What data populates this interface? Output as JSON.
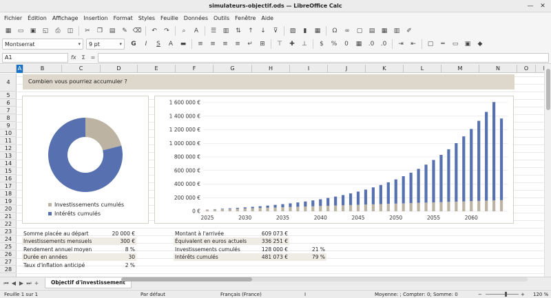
{
  "window": {
    "title": "simulateurs-objectif.ods — LibreOffice Calc",
    "minimize": "—",
    "close": "✕"
  },
  "menu": [
    "Fichier",
    "Édition",
    "Affichage",
    "Insertion",
    "Format",
    "Styles",
    "Feuille",
    "Données",
    "Outils",
    "Fenêtre",
    "Aide"
  ],
  "toolbar": {
    "font_name": "Montserrat",
    "font_size": "9 pt",
    "bold": "G",
    "italic": "I",
    "underline": "S",
    "icons1": [
      "grid-icon",
      "open-icon",
      "save-icon",
      "export-pdf-icon",
      "print-icon",
      "print-preview-icon",
      "cut-icon",
      "copy-icon",
      "paste-icon",
      "clone-format-icon",
      "clear-format-icon",
      "undo-icon",
      "redo-icon",
      "find-icon",
      "spelling-icon",
      "row-icon",
      "column-icon",
      "sort-icon",
      "sort-asc-icon",
      "sort-desc-icon",
      "autofilter-icon",
      "image-icon",
      "chart-icon",
      "pivot-icon",
      "special-char-icon",
      "hyperlink-icon",
      "comment-icon",
      "header-footer-icon",
      "freeze-icon",
      "split-icon",
      "draw-icon"
    ],
    "icons2": [
      "font-color-icon",
      "highlight-icon",
      "align-left-icon",
      "align-center-icon",
      "align-right-icon",
      "justify-icon",
      "wrap-icon",
      "merge-icon",
      "align-top-icon",
      "align-middle-icon",
      "align-bottom-icon",
      "currency-icon",
      "percent-icon",
      "number-icon",
      "date-icon",
      "decimal-add-icon",
      "decimal-remove-icon",
      "indent-more-icon",
      "indent-less-icon",
      "borders-icon",
      "border-style-icon",
      "border-color-icon",
      "cond-format-icon",
      "styles-icon"
    ]
  },
  "formula": {
    "cell_ref": "A1",
    "fx": "fx",
    "sum": "Σ",
    "eq": "="
  },
  "columns": [
    "A",
    "B",
    "C",
    "D",
    "E",
    "F",
    "G",
    "H",
    "I",
    "J",
    "K",
    "L",
    "M",
    "N",
    "O",
    "P"
  ],
  "rows": [
    "4",
    "5",
    "6",
    "7",
    "8",
    "9",
    "10",
    "11",
    "12",
    "13",
    "14",
    "15",
    "16",
    "17",
    "18",
    "19",
    "20",
    "21",
    "22",
    "23",
    "24",
    "25",
    "26",
    "27",
    "28"
  ],
  "banner": "Combien vous pourriez accumuler ?",
  "donut": {
    "legend": [
      "Investissements cumulés",
      "Intérêts cumulés"
    ],
    "fractions": [
      0.21,
      0.79
    ],
    "colors": [
      "#bcb3a3",
      "#5670b0"
    ]
  },
  "chart_data": [
    {
      "type": "pie",
      "labels": [
        "Investissements cumulés",
        "Intérêts cumulés"
      ],
      "values": [
        128000,
        481073
      ]
    },
    {
      "type": "bar",
      "stacked": true,
      "x": [
        2025,
        2026,
        2027,
        2028,
        2029,
        2030,
        2031,
        2032,
        2033,
        2034,
        2035,
        2036,
        2037,
        2038,
        2039,
        2040,
        2041,
        2042,
        2043,
        2044,
        2045,
        2046,
        2047,
        2048,
        2049,
        2050,
        2051,
        2052,
        2053,
        2054,
        2055,
        2056,
        2057,
        2058,
        2059,
        2060,
        2061,
        2062,
        2063,
        2064
      ],
      "x_ticks": [
        "2025",
        "2030",
        "2035",
        "2040",
        "2045",
        "2050",
        "2055",
        "2060"
      ],
      "y_ticks": [
        "0 €",
        "200 000 €",
        "400 000 €",
        "600 000 €",
        "800 000 €",
        "1 000 000 €",
        "1 200 000 €",
        "1 400 000 €",
        "1 600 000 €"
      ],
      "ylim": [
        0,
        1600000
      ],
      "series": [
        {
          "name": "Investissements cumulés",
          "values": [
            23600,
            27200,
            30800,
            34400,
            38000,
            41600,
            45200,
            48800,
            52400,
            56000,
            59600,
            63200,
            66800,
            70400,
            74000,
            77600,
            81200,
            84800,
            88400,
            92000,
            95600,
            99200,
            102800,
            106400,
            110000,
            113600,
            117200,
            120800,
            124400,
            128000,
            131600,
            135200,
            138800,
            142400,
            146000,
            149600,
            153200,
            156800,
            160400,
            164000
          ]
        },
        {
          "name": "Intérêts cumulés",
          "values": [
            1900,
            4000,
            6500,
            9400,
            12700,
            16500,
            20900,
            25900,
            31600,
            38100,
            45500,
            53900,
            63400,
            74000,
            86000,
            99400,
            114500,
            131300,
            150100,
            171000,
            194300,
            220200,
            249000,
            280900,
            316300,
            355500,
            398900,
            446900,
            500000,
            558600,
            623300,
            694700,
            773500,
            860400,
            956200,
            1061700,
            1177900,
            1305900,
            1446700,
            1201000
          ]
        }
      ],
      "colors": [
        "#bcb3a3",
        "#5670b0"
      ],
      "grid": true
    }
  ],
  "table_left": [
    {
      "label": "Somme placée au départ",
      "value": "20 000 €"
    },
    {
      "label": "Investissements mensuels",
      "value": "300 €"
    },
    {
      "label": "Rendement annuel moyen",
      "value": "8 %"
    },
    {
      "label": "Durée en années",
      "value": "30"
    },
    {
      "label": "Taux d'inflation anticipé",
      "value": "2 %"
    }
  ],
  "table_right": [
    {
      "label": "Montant à l'arrivée",
      "value": "609 073 €",
      "pct": ""
    },
    {
      "label": "Équivalent en euros actuels",
      "value": "336 251 €",
      "pct": ""
    },
    {
      "label": "Investissements cumulés",
      "value": "128 000 €",
      "pct": "21 %"
    },
    {
      "label": "Intérêts cumulés",
      "value": "481 073 €",
      "pct": "79 %"
    }
  ],
  "sheet_tab": "Objectif d'investissement",
  "status": {
    "sheet": "Feuille 1 sur 1",
    "style": "Par défaut",
    "lang": "Français (France)",
    "stats": "Moyenne: ; Compter: 0; Somme: 0",
    "zoom": "120 %",
    "zoom_level": 0.6
  }
}
